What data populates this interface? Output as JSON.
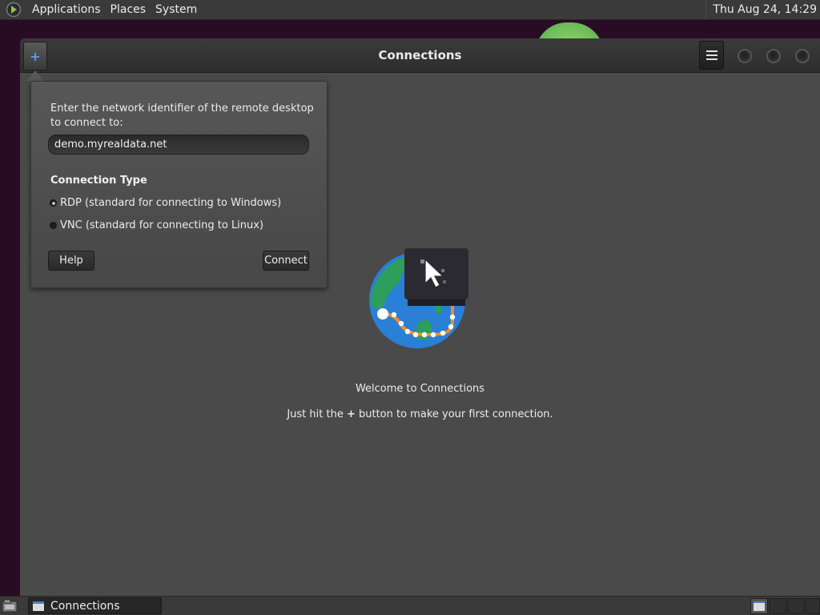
{
  "top_panel": {
    "menus": [
      "Applications",
      "Places",
      "System"
    ],
    "clock": "Thu Aug 24, 14:29"
  },
  "window": {
    "title": "Connections",
    "add_button_label": "+",
    "popover": {
      "prompt": "Enter the network identifier of the remote desktop to connect to:",
      "address_value": "demo.myrealdata.net",
      "connection_type_label": "Connection Type",
      "options": [
        {
          "label": "RDP (standard for connecting to Windows)",
          "selected": true
        },
        {
          "label": "VNC (standard for connecting to Linux)",
          "selected": false
        }
      ],
      "help_label": "Help",
      "connect_label": "Connect"
    },
    "welcome": {
      "title": "Welcome to Connections",
      "hint_before": "Just hit the ",
      "hint_plus": "+",
      "hint_after": " button to make your first connection."
    }
  },
  "taskbar": {
    "task_label": "Connections"
  },
  "colors": {
    "accent": "#5b9ae6",
    "panel": "#3a3a3a",
    "window_bg": "#4a4a4a"
  }
}
